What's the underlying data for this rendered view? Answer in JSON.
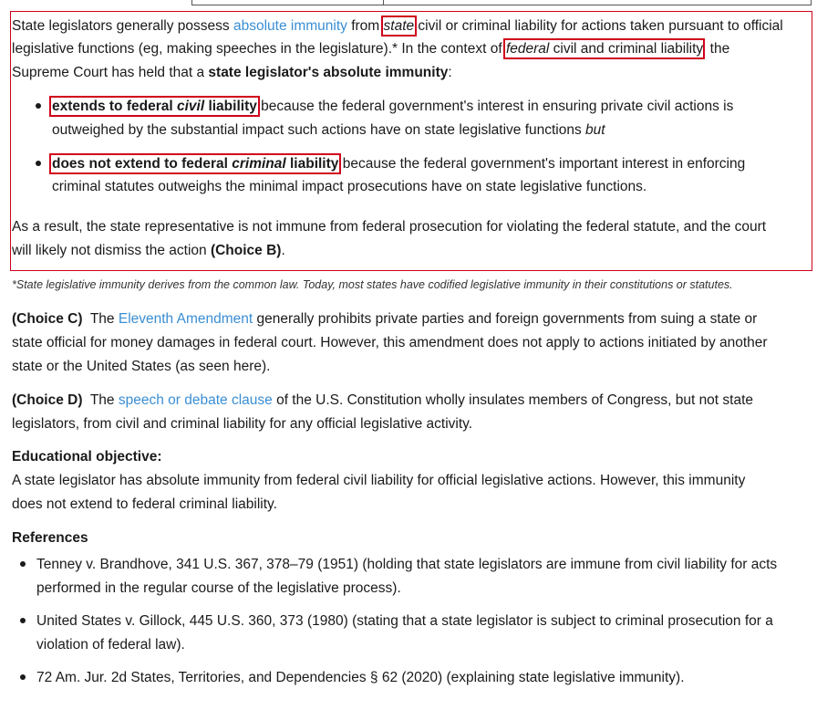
{
  "explanation": {
    "p1_a": "State legislators generally possess ",
    "p1_link": "absolute immunity",
    "p1_b": " from ",
    "p1_state": "state",
    "p1_c": " civil or criminal liability for actions taken pursuant to official",
    "p1_line2_a": "legislative functions (eg, making speeches in the legislature).*  In the context of ",
    "p1_federal": "federal",
    "p1_line2_b": " civil and criminal liability",
    "p1_line2_c": ", the",
    "p1_line3_a": "Supreme Court has held that a ",
    "p1_line3_bold": "state legislator's absolute immunity",
    "p1_line3_c": ":",
    "bullet1_bold_a": "extends to federal ",
    "bullet1_bold_i": "civil",
    "bullet1_bold_b": " liability",
    "bullet1_rest": " because the federal government's interest in ensuring private civil actions is",
    "bullet1_line2_a": "outweighed by the substantial impact such actions have on state legislative functions ",
    "bullet1_line2_i": "but",
    "bullet2_bold_a": "does not extend to federal ",
    "bullet2_bold_i": "criminal",
    "bullet2_bold_b": " liability",
    "bullet2_rest": " because the federal government's important interest in enforcing",
    "bullet2_line2": "criminal statutes outweighs the minimal impact prosecutions have on state legislative functions.",
    "result_line1": "As a result, the state representative is not immune from federal prosecution for violating the federal statute, and the court",
    "result_line2_a": "will likely not dismiss the action ",
    "result_line2_bold": "(Choice B)",
    "result_line2_c": "."
  },
  "footnote": "*State legislative immunity derives from the common law.  Today, most states have codified legislative immunity in their constitutions or statutes.",
  "choice_c": {
    "label": "(Choice C)",
    "a": "  The ",
    "link": "Eleventh Amendment",
    "b": " generally prohibits private parties and foreign governments from suing a state or",
    "line2": "state official for money damages in federal court.  However, this amendment does not apply to actions initiated by another",
    "line3": "state or the United States (as seen here)."
  },
  "choice_d": {
    "label": "(Choice D)",
    "a": "  The ",
    "link": "speech or debate clause",
    "b": " of the U.S. Constitution wholly insulates members of Congress, but not state",
    "line2": "legislators, from civil and criminal liability for any official legislative activity."
  },
  "objective": {
    "heading": "Educational objective:",
    "line1": "A state legislator has absolute immunity from federal civil liability for official legislative actions.  However, this immunity",
    "line2": "does not extend to federal criminal liability."
  },
  "references": {
    "heading": "References",
    "items": [
      {
        "line1": "Tenney v. Brandhove, 341 U.S. 367, 378–79 (1951) (holding that state legislators are immune from civil liability for acts",
        "line2": "performed in the regular course of the legislative process)."
      },
      {
        "line1": "United States v. Gillock, 445 U.S. 360, 373 (1980) (stating that a state legislator is subject to criminal prosecution for a",
        "line2": "violation of federal law)."
      },
      {
        "line1": "72 Am. Jur. 2d States, Territories, and Dependencies § 62 (2020) (explaining state legislative immunity).",
        "line2": ""
      }
    ]
  }
}
